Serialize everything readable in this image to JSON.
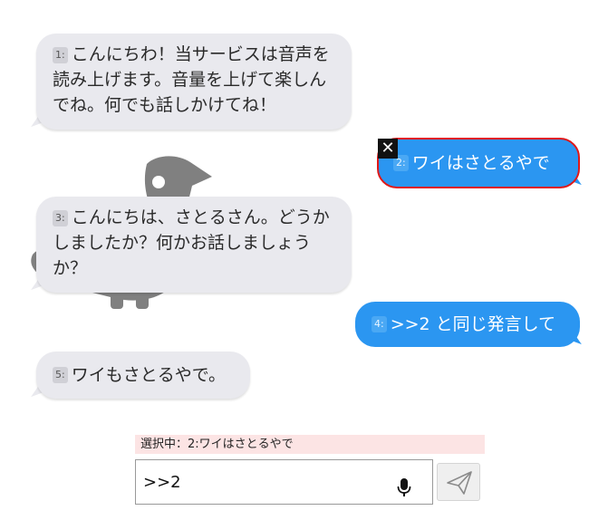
{
  "messages": [
    {
      "num": "1:",
      "text": "こんにちわ！当サービスは音声を読み上げます。音量を上げて楽しんでね。何でも話しかけてね！"
    },
    {
      "num": "2:",
      "text": "ワイはさとるやで"
    },
    {
      "num": "3:",
      "text": "こんにちは、さとるさん。どうかしましたか？何かお話しましょうか？"
    },
    {
      "num": "4:",
      "text": ">>2 と同じ発言して"
    },
    {
      "num": "5:",
      "text": "ワイもさとるやで。"
    }
  ],
  "close_icon": "✕",
  "selected_label": "選択中：2:ワイはさとるやで",
  "input": {
    "value": ">>2",
    "placeholder": ""
  },
  "icons": {
    "mic": "microphone-icon",
    "send": "paper-plane-icon",
    "close": "close-icon"
  },
  "colors": {
    "user_bubble": "#2b96f1",
    "bot_bubble": "#e9e9ee",
    "selected_border": "#e01818",
    "selected_bg": "#fce4e4"
  }
}
